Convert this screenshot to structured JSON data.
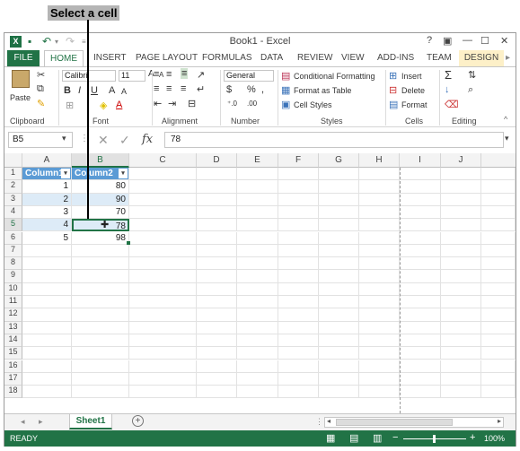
{
  "annotation": {
    "callout": "Select a cell"
  },
  "window": {
    "title": "Book1 - Excel",
    "help": "?",
    "min": "—",
    "max": "☐",
    "close": "✕"
  },
  "tabs": [
    "FILE",
    "HOME",
    "INSERT",
    "PAGE LAYOUT",
    "FORMULAS",
    "DATA",
    "REVIEW",
    "VIEW",
    "ADD-INS",
    "TEAM",
    "DESIGN"
  ],
  "ribbon": {
    "paste": "Paste",
    "font_name": "Calibri",
    "font_size": "11",
    "number_format": "General",
    "conditional_formatting": "Conditional Formatting",
    "format_as_table": "Format as Table",
    "cell_styles": "Cell Styles",
    "insert": "Insert",
    "delete": "Delete",
    "format": "Format",
    "groups": {
      "clipboard": "Clipboard",
      "font": "Font",
      "alignment": "Alignment",
      "number": "Number",
      "styles": "Styles",
      "cells": "Cells",
      "editing": "Editing"
    }
  },
  "formula_bar": {
    "name_box": "B5",
    "value": "78",
    "fx": "fx"
  },
  "grid": {
    "columns": [
      "A",
      "B",
      "C",
      "D",
      "E",
      "F",
      "G",
      "H",
      "I",
      "J"
    ],
    "rows": [
      "1",
      "2",
      "3",
      "4",
      "5",
      "6",
      "7",
      "8",
      "9",
      "10",
      "11",
      "12",
      "13",
      "14",
      "15",
      "16",
      "17",
      "18"
    ],
    "table": {
      "headers": [
        "Column1",
        "Column2"
      ],
      "rows": [
        [
          "1",
          "80"
        ],
        [
          "2",
          "90"
        ],
        [
          "3",
          "70"
        ],
        [
          "4",
          "78"
        ],
        [
          "5",
          "98"
        ]
      ]
    }
  },
  "sheets": {
    "active": "Sheet1"
  },
  "status": {
    "ready": "READY",
    "zoom": "100%"
  }
}
